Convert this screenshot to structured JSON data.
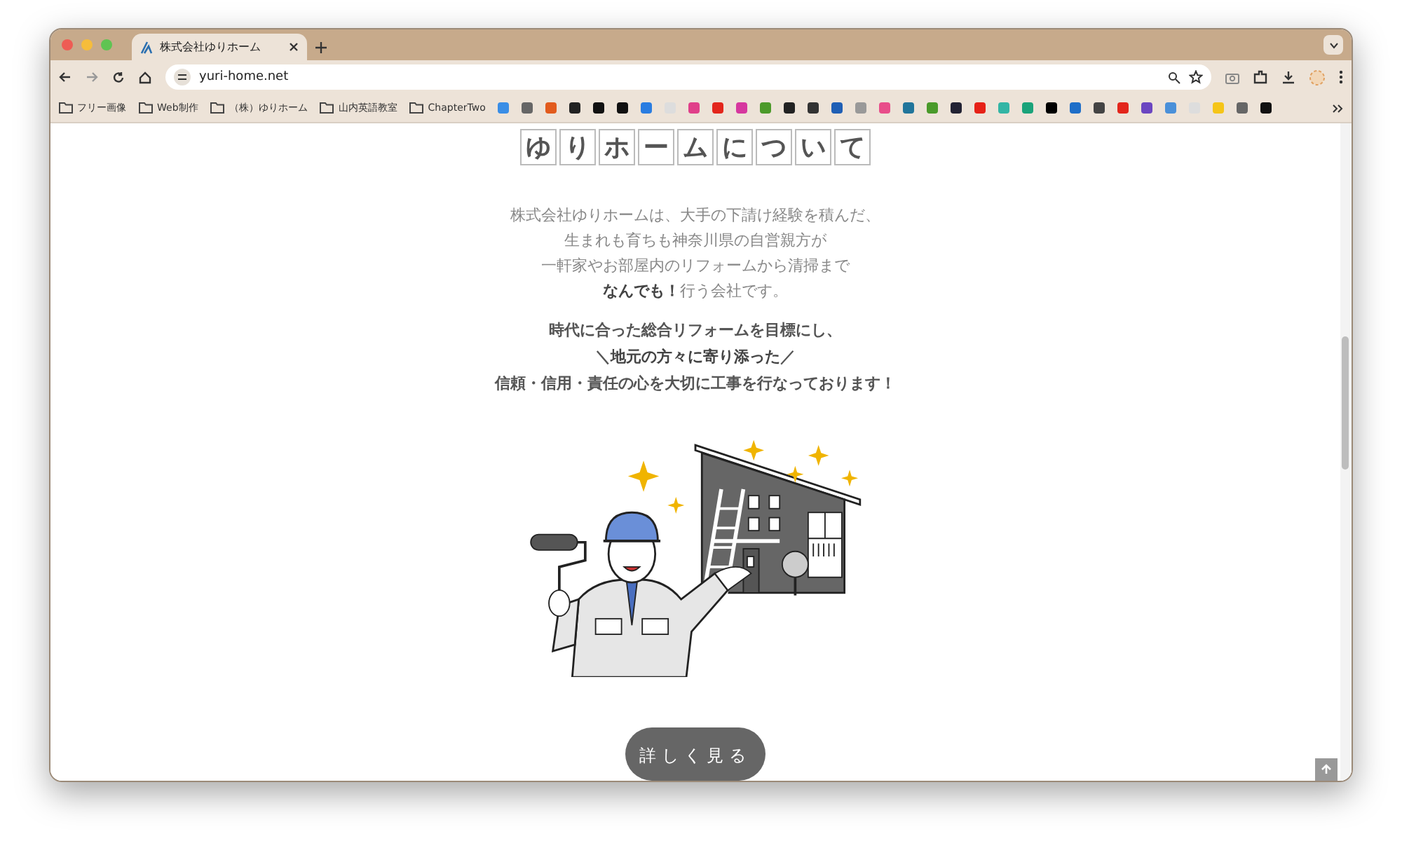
{
  "browser": {
    "tab": {
      "title": "株式会社ゆりホーム",
      "selected": true
    },
    "url": "yuri-home.net",
    "bookmarks": [
      {
        "label": "フリー画像"
      },
      {
        "label": "Web制作"
      },
      {
        "label": "（株）ゆりホーム"
      },
      {
        "label": "山内英語教室"
      },
      {
        "label": "ChapterTwo"
      }
    ]
  },
  "page": {
    "heading_chars": [
      "ゆ",
      "り",
      "ホ",
      "ー",
      "ム",
      "に",
      "つ",
      "い",
      "て"
    ],
    "intro_lines": [
      "株式会社ゆりホームは、大手の下請け経験を積んだ、",
      "生まれも育ちも神奈川県の自営親方が",
      "一軒家やお部屋内のリフォームから清掃まで",
      "**なんでも！**行う会社です。"
    ],
    "mission_lines": [
      "時代に合った総合リフォームを目標にし、",
      "＼**地元の方々に寄り添った**／",
      "信頼・信用・責任の心を大切に工事を行なっております！"
    ],
    "more_button": "詳しく見る"
  }
}
